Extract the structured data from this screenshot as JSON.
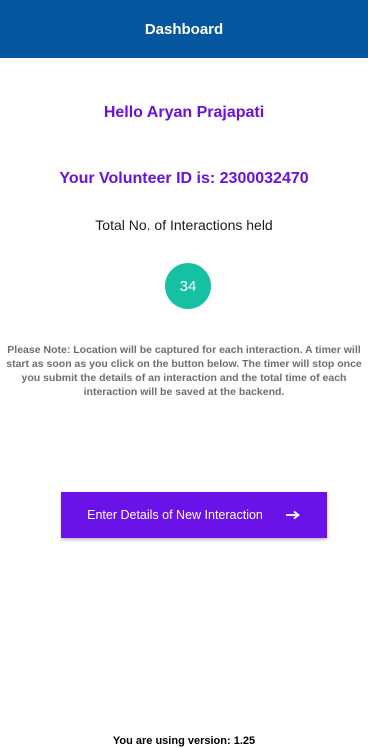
{
  "app_bar": {
    "title": "Dashboard",
    "background": "#04579e"
  },
  "greeting": "Hello Aryan Prajapati",
  "volunteer_id_text": "Your Volunteer ID is: 2300032470",
  "interactions": {
    "label": "Total No. of Interactions held",
    "count": "34",
    "badge_color": "#16c1a3"
  },
  "note": "Please Note: Location will be captured for each interaction. A timer will start as soon as you click on the button below. The timer will stop once you submit the details of an interaction and the total time of each interaction will be saved at the backend.",
  "primary_button": {
    "label": "Enter Details of New Interaction",
    "icon": "arrow-right-icon",
    "color": "#6a12e8"
  },
  "version_text": "You are using version: 1.25",
  "accent_color": "#6a12d9"
}
